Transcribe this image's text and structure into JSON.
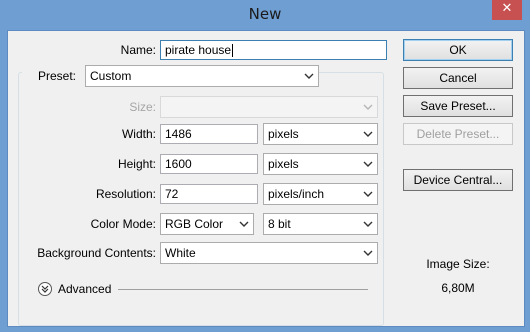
{
  "window": {
    "title": "New",
    "close_glyph": "✕"
  },
  "form": {
    "name_label": "Name:",
    "name_value": "pirate house",
    "preset_label": "Preset:",
    "preset_value": "Custom",
    "size_label": "Size:",
    "size_value": "",
    "width_label": "Width:",
    "width_value": "1486",
    "width_unit": "pixels",
    "height_label": "Height:",
    "height_value": "1600",
    "height_unit": "pixels",
    "resolution_label": "Resolution:",
    "resolution_value": "72",
    "resolution_unit": "pixels/inch",
    "color_mode_label": "Color Mode:",
    "color_mode_value": "RGB Color",
    "bit_depth_value": "8 bit",
    "background_label": "Background Contents:",
    "background_value": "White",
    "advanced_label": "Advanced"
  },
  "buttons": {
    "ok": "OK",
    "cancel": "Cancel",
    "save_preset": "Save Preset...",
    "delete_preset": "Delete Preset...",
    "device_central": "Device Central..."
  },
  "image_size": {
    "label": "Image Size:",
    "value": "6,80M"
  },
  "icons": {
    "dropdown": "chevron-down-icon",
    "advanced": "double-chevron-down-icon",
    "close": "close-icon"
  },
  "colors": {
    "title_bar": "#6f9fd2",
    "close_button": "#c75050",
    "dialog_bg": "#f0f0f0",
    "focus_border": "#3c7fb1"
  }
}
